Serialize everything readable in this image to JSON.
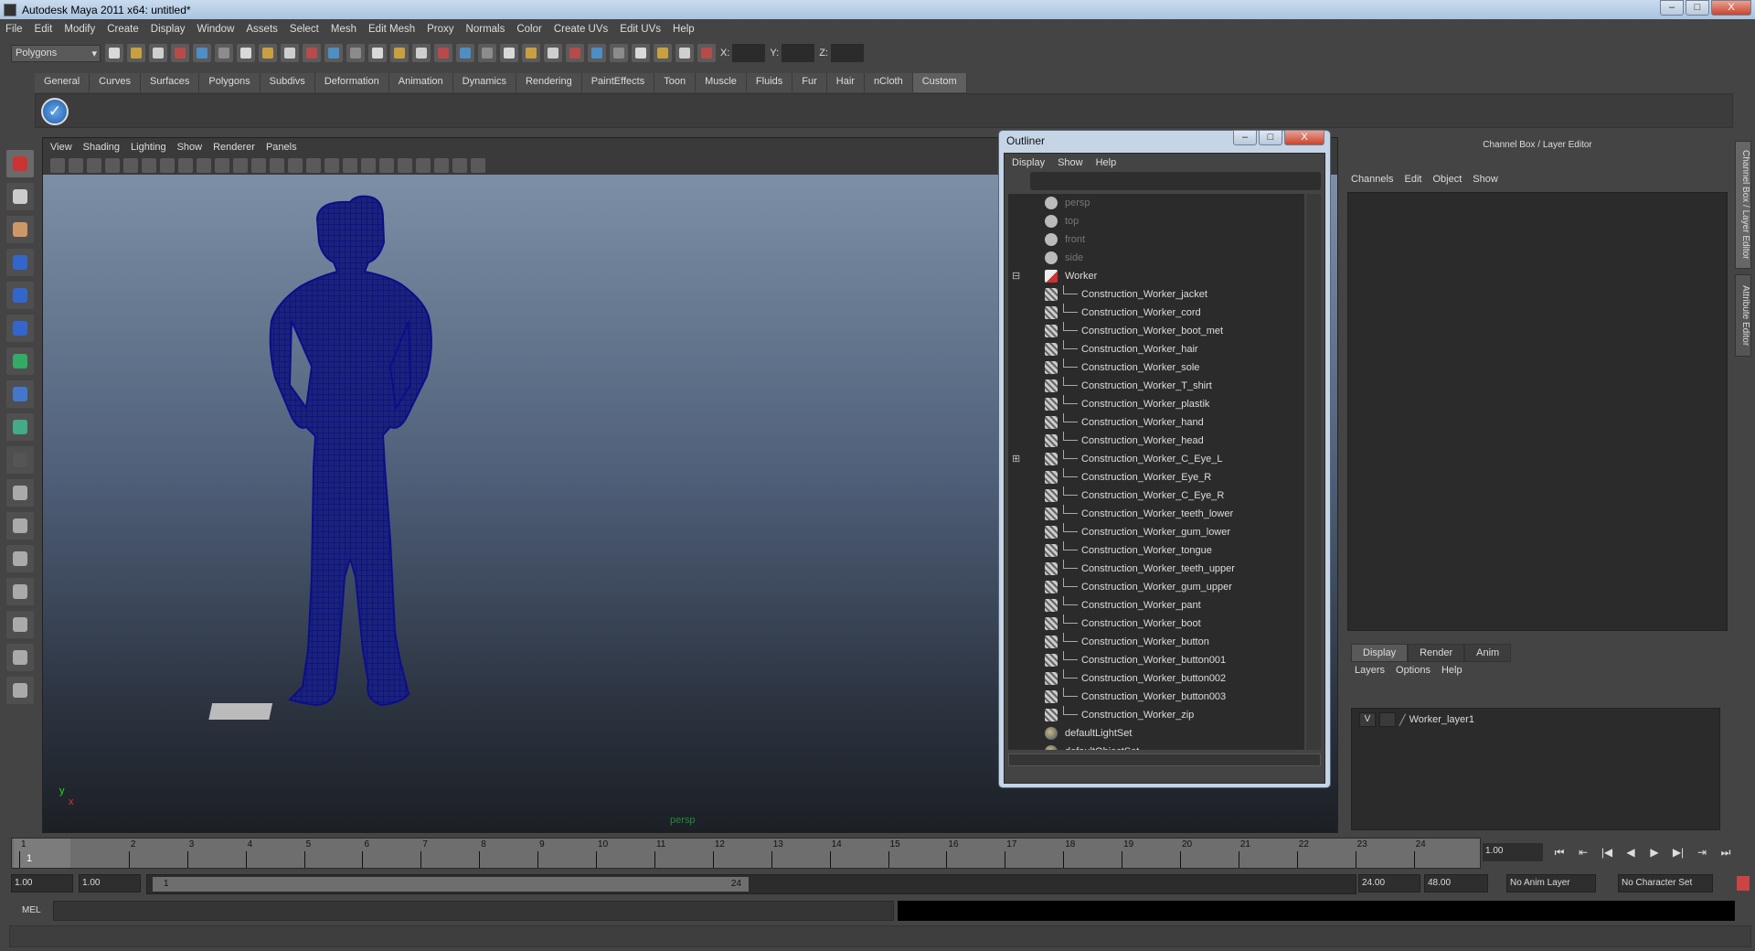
{
  "window": {
    "title": "Autodesk Maya 2011 x64: untitled*",
    "buttons": [
      "–",
      "□",
      "X"
    ]
  },
  "menubar": [
    "File",
    "Edit",
    "Modify",
    "Create",
    "Display",
    "Window",
    "Assets",
    "Select",
    "Mesh",
    "Edit Mesh",
    "Proxy",
    "Normals",
    "Color",
    "Create UVs",
    "Edit UVs",
    "Help"
  ],
  "toolbar": {
    "menuset": "Polygons",
    "icons": [
      "new-scene",
      "open-scene",
      "save-scene",
      "select-hierarchy",
      "select-object",
      "select-component",
      "snap-grid",
      "snap-curve",
      "snap-point",
      "snap-plane",
      "snap-live",
      "snap-view",
      "snap-surface",
      "help",
      "lock",
      "input-ops",
      "render-region",
      "ipr-render",
      "render-settings",
      "hypershade",
      "render-view",
      "construction-history",
      "show-inputs",
      "show-outputs",
      "attribute-editor",
      "uv-editor",
      "paint-tool",
      "graph-editor"
    ],
    "x_label": "X:",
    "y_label": "Y:",
    "z_label": "Z:"
  },
  "shelf": {
    "tabs": [
      "General",
      "Curves",
      "Surfaces",
      "Polygons",
      "Subdivs",
      "Deformation",
      "Animation",
      "Dynamics",
      "Rendering",
      "PaintEffects",
      "Toon",
      "Muscle",
      "Fluids",
      "Fur",
      "Hair",
      "nCloth",
      "Custom"
    ],
    "active_tab": "Custom",
    "button_glyph": "✓"
  },
  "tools": [
    "select-tool",
    "lasso-tool",
    "paint-select-tool",
    "move-tool",
    "rotate-tool",
    "scale-tool",
    "universal-manipulator",
    "soft-mod-tool",
    "show-manipulator",
    "last-tool",
    "single-perspective-layout",
    "four-view-layout",
    "outliner-persp-layout",
    "graph-persp-layout",
    "hypershade-layout",
    "outliner-graph-layout",
    "hypergraph-layout"
  ],
  "viewport": {
    "menu": [
      "View",
      "Shading",
      "Lighting",
      "Show",
      "Renderer",
      "Panels"
    ],
    "icon_count": 24,
    "camera_label": "persp",
    "axis_y": "y",
    "axis_x": "x",
    "wire_color": "#0b0e8a"
  },
  "outliner": {
    "title": "Outliner",
    "menu": [
      "Display",
      "Show",
      "Help"
    ],
    "items": [
      {
        "label": "persp",
        "type": "camera",
        "level": 0,
        "dim": true
      },
      {
        "label": "top",
        "type": "camera",
        "level": 0,
        "dim": true
      },
      {
        "label": "front",
        "type": "camera",
        "level": 0,
        "dim": true
      },
      {
        "label": "side",
        "type": "camera",
        "level": 0,
        "dim": true
      },
      {
        "label": "Worker",
        "type": "group",
        "level": 0,
        "expanded": true
      },
      {
        "label": "Construction_Worker_jacket",
        "type": "mesh",
        "level": 1
      },
      {
        "label": "Construction_Worker_cord",
        "type": "mesh",
        "level": 1
      },
      {
        "label": "Construction_Worker_boot_met",
        "type": "mesh",
        "level": 1
      },
      {
        "label": "Construction_Worker_hair",
        "type": "mesh",
        "level": 1
      },
      {
        "label": "Construction_Worker_sole",
        "type": "mesh",
        "level": 1
      },
      {
        "label": "Construction_Worker_T_shirt",
        "type": "mesh",
        "level": 1
      },
      {
        "label": "Construction_Worker_plastik",
        "type": "mesh",
        "level": 1
      },
      {
        "label": "Construction_Worker_hand",
        "type": "mesh",
        "level": 1
      },
      {
        "label": "Construction_Worker_head",
        "type": "mesh",
        "level": 1
      },
      {
        "label": "Construction_Worker_C_Eye_L",
        "type": "mesh",
        "level": 1,
        "collapsed_toggle": true
      },
      {
        "label": "Construction_Worker_Eye_R",
        "type": "mesh",
        "level": 1
      },
      {
        "label": "Construction_Worker_C_Eye_R",
        "type": "mesh",
        "level": 1
      },
      {
        "label": "Construction_Worker_teeth_lower",
        "type": "mesh",
        "level": 1
      },
      {
        "label": "Construction_Worker_gum_lower",
        "type": "mesh",
        "level": 1
      },
      {
        "label": "Construction_Worker_tongue",
        "type": "mesh",
        "level": 1
      },
      {
        "label": "Construction_Worker_teeth_upper",
        "type": "mesh",
        "level": 1
      },
      {
        "label": "Construction_Worker_gum_upper",
        "type": "mesh",
        "level": 1
      },
      {
        "label": "Construction_Worker_pant",
        "type": "mesh",
        "level": 1
      },
      {
        "label": "Construction_Worker_boot",
        "type": "mesh",
        "level": 1
      },
      {
        "label": "Construction_Worker_button",
        "type": "mesh",
        "level": 1
      },
      {
        "label": "Construction_Worker_button001",
        "type": "mesh",
        "level": 1
      },
      {
        "label": "Construction_Worker_button002",
        "type": "mesh",
        "level": 1
      },
      {
        "label": "Construction_Worker_button003",
        "type": "mesh",
        "level": 1
      },
      {
        "label": "Construction_Worker_zip",
        "type": "mesh",
        "level": 1
      },
      {
        "label": "defaultLightSet",
        "type": "set",
        "level": 0
      },
      {
        "label": "defaultObjectSet",
        "type": "set",
        "level": 0
      }
    ]
  },
  "channel_box": {
    "title": "Channel Box / Layer Editor",
    "menu": [
      "Channels",
      "Edit",
      "Object",
      "Show"
    ],
    "layer_tabs": [
      "Display",
      "Render",
      "Anim"
    ],
    "active_layer_tab": "Display",
    "layer_menu": [
      "Layers",
      "Options",
      "Help"
    ],
    "layers": [
      {
        "visible": "V",
        "name": "Worker_layer1"
      }
    ]
  },
  "side_tabs": [
    "Channel Box / Layer Editor",
    "Attribute Editor"
  ],
  "timeline": {
    "frames": [
      1,
      2,
      3,
      4,
      5,
      6,
      7,
      8,
      9,
      10,
      11,
      12,
      13,
      14,
      15,
      16,
      17,
      18,
      19,
      20,
      21,
      22,
      23,
      24
    ],
    "current_frame_marker": "1",
    "current_frame": "1.00"
  },
  "playback": [
    "⏮",
    "⇤",
    "|◀",
    "◀",
    "▶",
    "▶|",
    "⇥",
    "⏭"
  ],
  "range": {
    "start_time": "1.00",
    "playback_start": "1.00",
    "range_start": "1",
    "range_end": "24",
    "playback_end": "24.00",
    "end_time": "48.00",
    "anim_layer": "No Anim Layer",
    "character_set": "No Character Set"
  },
  "command_line": {
    "label": "MEL"
  }
}
